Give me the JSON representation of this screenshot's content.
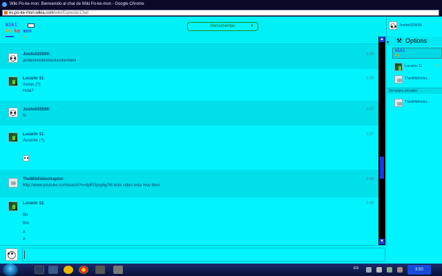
{
  "window": {
    "title": "Wiki Po-ke-mon: Bienvenido al chat de Wiki Po-ke-mon - Google Chrome",
    "url_domain": "es.po-ke-mon.wikia.com",
    "url_path": "/wiki/Especial:Chat"
  },
  "header": {
    "logo_line1": "Wiki",
    "logo_line2_a": "Po",
    "logo_line2_b": "ke",
    "logo_line2_c": "mon",
    "tools_label": "Herramientas",
    "tools_caret": "▼"
  },
  "messages": [
    {
      "user": "Josito020599:",
      "avatar": "panda-avatar",
      "time": "3:35",
      "lines": [
        "asdasdasdasdasdasdasdasd"
      ]
    },
    {
      "user": "Lucario 11:",
      "avatar": "green-avatar",
      "time": "3:35",
      "lines": [
        "Asdas (?)",
        "Hola?"
      ]
    },
    {
      "user": "Josito020599:",
      "avatar": "panda-avatar",
      "time": "3:37",
      "lines": [
        "hi"
      ]
    },
    {
      "user": "Lucario 11:",
      "avatar": "green-avatar",
      "time": "3:37",
      "lines": [
        "Ausente (?)"
      ]
    },
    {
      "user": "TheWildVelociraptor:",
      "avatar": "raptor-avatar",
      "time": "3:48",
      "link": "http://www.youtube.com/watch?v=8pEGprg4g7M",
      "link_rest": " este video esta muy bien"
    },
    {
      "user": "Lucario 11:",
      "avatar": "green-avatar",
      "time": "3:49",
      "lines": [
        "Bn",
        "Bm",
        "A",
        "A"
      ]
    }
  ],
  "rail": {
    "me": "Josito020599",
    "options_label": "Options",
    "room_line1": "Wiki",
    "room_line2": "Po",
    "users": [
      {
        "name": "Lucario 11",
        "avatar": "green-avatar",
        "star": "☆"
      },
      {
        "name": "TheWildVelci...",
        "avatar": "raptor-avatar",
        "star": ""
      }
    ],
    "private_label": "Mensajes privados",
    "private_users": [
      {
        "name": "TheWildVelci...",
        "avatar": "raptor-avatar"
      }
    ]
  },
  "taskbar": {
    "lang": "ES",
    "clock": "3:50"
  },
  "colors": {
    "page_bg": "#00f4ff",
    "link": "#1a4acd",
    "username": "#0a3a6a",
    "scroll": "#1a3adb"
  }
}
